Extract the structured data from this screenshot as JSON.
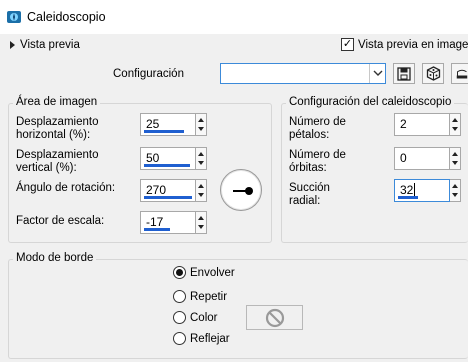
{
  "window": {
    "title": "Caleidoscopio"
  },
  "preview": {
    "toggle_label": "Vista previa",
    "window_preview_label": "Vista previa en imagen",
    "window_preview_checked": true
  },
  "config": {
    "label": "Configuración",
    "value": ""
  },
  "image_area": {
    "title": "Área de imagen",
    "h_offset": {
      "label1": "Desplazamiento",
      "label2": "horizontal (%):",
      "value": "25",
      "level": 0.42
    },
    "v_offset": {
      "label1": "Desplazamiento",
      "label2": "vertical (%):",
      "value": "50",
      "level": 0.62
    },
    "rotation": {
      "label": "Ángulo de rotación:",
      "value": "270",
      "level": 0.75
    },
    "scale": {
      "label": "Factor de escala:",
      "value": "-17",
      "level": 0.25
    }
  },
  "kaleido": {
    "title": "Configuración del caleidoscopio",
    "petals": {
      "label1": "Número de",
      "label2": "pétalos:",
      "value": "2"
    },
    "orbits": {
      "label1": "Número de",
      "label2": "órbitas:",
      "value": "0"
    },
    "suction": {
      "label1": "Succión",
      "label2": "radial:",
      "value": "32",
      "level": 0.32
    }
  },
  "edge_mode": {
    "title": "Modo de borde",
    "options": [
      "Envolver",
      "Repetir",
      "Color",
      "Reflejar"
    ],
    "selected": "Envolver"
  },
  "colors": {
    "accent": "#1f5fd0",
    "focus": "#3c8ad9"
  }
}
